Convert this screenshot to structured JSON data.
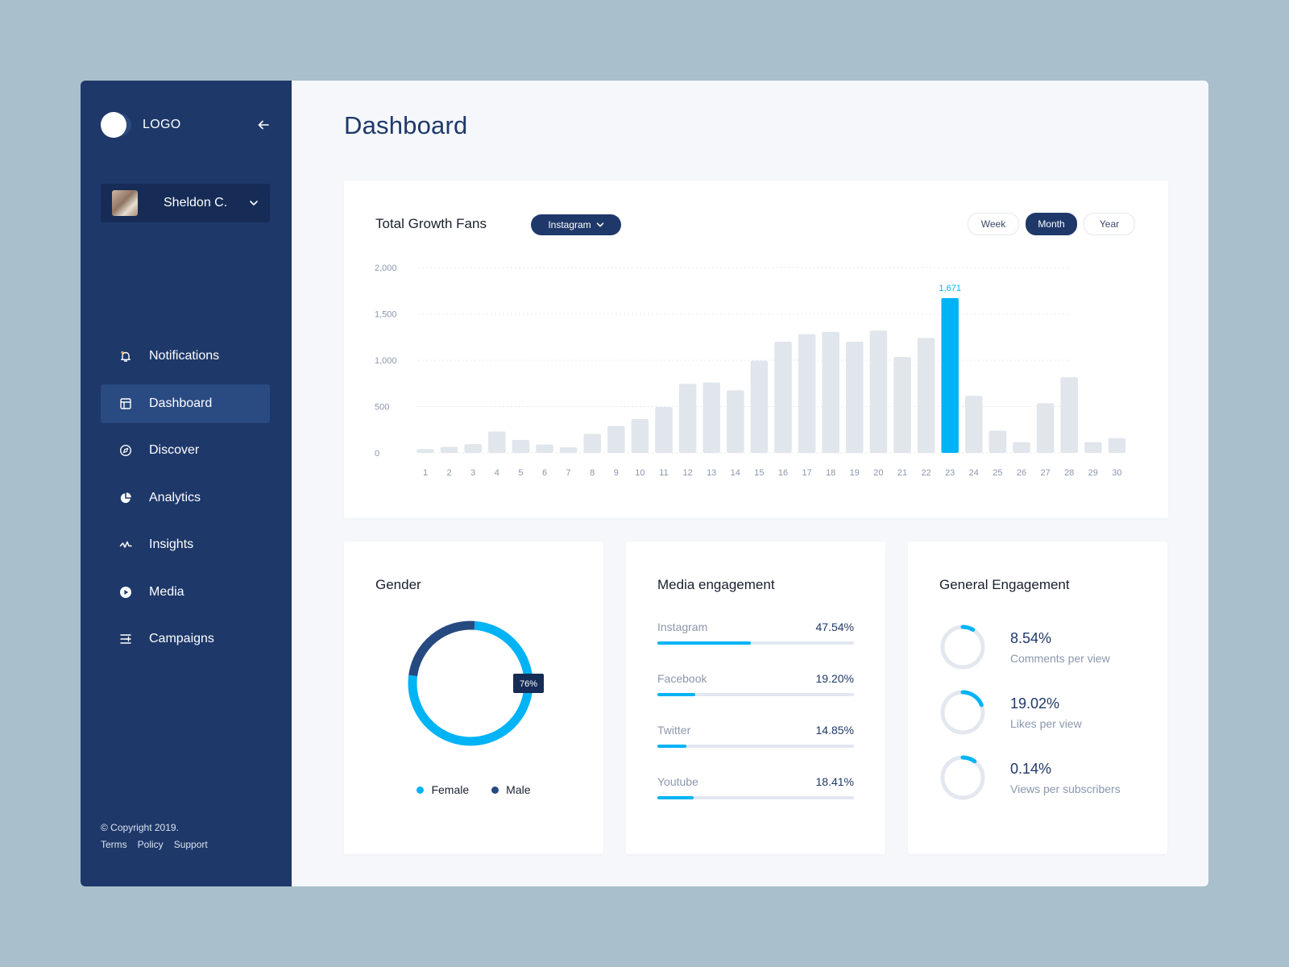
{
  "sidebar": {
    "logo_text": "LOGO",
    "user_name": "Sheldon C.",
    "nav": [
      {
        "label": "Notifications",
        "icon": "bell-icon"
      },
      {
        "label": "Dashboard",
        "icon": "layout-icon",
        "active": true
      },
      {
        "label": "Discover",
        "icon": "compass-icon"
      },
      {
        "label": "Analytics",
        "icon": "pie-chart-icon"
      },
      {
        "label": "Insights",
        "icon": "activity-icon"
      },
      {
        "label": "Media",
        "icon": "play-icon"
      },
      {
        "label": "Campaigns",
        "icon": "sliders-icon"
      }
    ],
    "copyright": "© Copyright 2019.",
    "footer_links": [
      "Terms",
      "Policy",
      "Support"
    ]
  },
  "main": {
    "page_title": "Dashboard",
    "growth_card": {
      "title": "Total Growth Fans",
      "platform_select": "Instagram",
      "ranges": [
        "Week",
        "Month",
        "Year"
      ],
      "active_range": "Month"
    },
    "gender_card": {
      "title": "Gender",
      "badge": "76%",
      "legend": [
        "Female",
        "Male"
      ]
    },
    "media_card": {
      "title": "Media engagement",
      "items": [
        {
          "name": "Instagram",
          "value": "47.54%",
          "percent": 47.54
        },
        {
          "name": "Facebook",
          "value": "19.20%",
          "percent": 19.2
        },
        {
          "name": "Twitter",
          "value": "14.85%",
          "percent": 14.85
        },
        {
          "name": "Youtube",
          "value": "18.41%",
          "percent": 18.41
        }
      ]
    },
    "general_card": {
      "title": "General Engagement",
      "items": [
        {
          "value": "8.54%",
          "label": "Comments per view",
          "arc_percent": 8.54
        },
        {
          "value": "19.02%",
          "label": "Likes per view",
          "arc_percent": 19.02
        },
        {
          "value": "0.14%",
          "label": "Views per subscribers",
          "arc_percent": 10
        }
      ]
    }
  },
  "colors": {
    "navy": "#1e3869",
    "accent": "#00b3f5",
    "bar_gray": "#e1e5ec",
    "muted_text": "#8b97ad"
  },
  "chart_data": [
    {
      "type": "bar",
      "categories": [
        "1",
        "2",
        "3",
        "4",
        "5",
        "6",
        "7",
        "8",
        "9",
        "10",
        "11",
        "12",
        "13",
        "14",
        "15",
        "16",
        "17",
        "18",
        "19",
        "20",
        "21",
        "22",
        "23",
        "24",
        "25",
        "26",
        "27",
        "28",
        "29",
        "30"
      ],
      "values": [
        40,
        65,
        95,
        230,
        140,
        90,
        60,
        205,
        290,
        365,
        495,
        745,
        760,
        675,
        995,
        1200,
        1280,
        1305,
        1200,
        1320,
        1035,
        1240,
        1671,
        615,
        240,
        115,
        535,
        815,
        115,
        160
      ],
      "highlight_index": 22,
      "highlight_label": "1,671",
      "yticks": [
        "2,000",
        "1,500",
        "1,000",
        "500",
        "0"
      ],
      "ylim": [
        0,
        2000
      ]
    },
    {
      "type": "pie",
      "categories": [
        "Female",
        "Male"
      ],
      "values": [
        76,
        24
      ]
    }
  ]
}
